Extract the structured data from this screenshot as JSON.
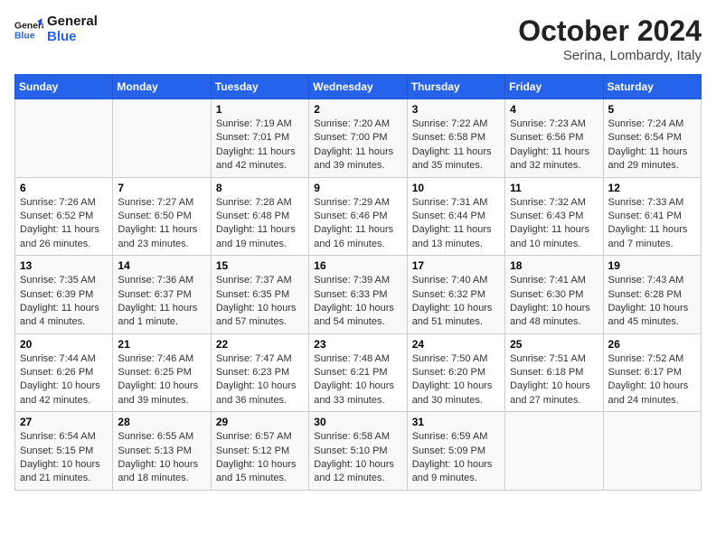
{
  "header": {
    "logo_general": "General",
    "logo_blue": "Blue",
    "month_title": "October 2024",
    "location": "Serina, Lombardy, Italy"
  },
  "days_of_week": [
    "Sunday",
    "Monday",
    "Tuesday",
    "Wednesday",
    "Thursday",
    "Friday",
    "Saturday"
  ],
  "weeks": [
    [
      {
        "day": "",
        "info": ""
      },
      {
        "day": "",
        "info": ""
      },
      {
        "day": "1",
        "info": "Sunrise: 7:19 AM\nSunset: 7:01 PM\nDaylight: 11 hours and 42 minutes."
      },
      {
        "day": "2",
        "info": "Sunrise: 7:20 AM\nSunset: 7:00 PM\nDaylight: 11 hours and 39 minutes."
      },
      {
        "day": "3",
        "info": "Sunrise: 7:22 AM\nSunset: 6:58 PM\nDaylight: 11 hours and 35 minutes."
      },
      {
        "day": "4",
        "info": "Sunrise: 7:23 AM\nSunset: 6:56 PM\nDaylight: 11 hours and 32 minutes."
      },
      {
        "day": "5",
        "info": "Sunrise: 7:24 AM\nSunset: 6:54 PM\nDaylight: 11 hours and 29 minutes."
      }
    ],
    [
      {
        "day": "6",
        "info": "Sunrise: 7:26 AM\nSunset: 6:52 PM\nDaylight: 11 hours and 26 minutes."
      },
      {
        "day": "7",
        "info": "Sunrise: 7:27 AM\nSunset: 6:50 PM\nDaylight: 11 hours and 23 minutes."
      },
      {
        "day": "8",
        "info": "Sunrise: 7:28 AM\nSunset: 6:48 PM\nDaylight: 11 hours and 19 minutes."
      },
      {
        "day": "9",
        "info": "Sunrise: 7:29 AM\nSunset: 6:46 PM\nDaylight: 11 hours and 16 minutes."
      },
      {
        "day": "10",
        "info": "Sunrise: 7:31 AM\nSunset: 6:44 PM\nDaylight: 11 hours and 13 minutes."
      },
      {
        "day": "11",
        "info": "Sunrise: 7:32 AM\nSunset: 6:43 PM\nDaylight: 11 hours and 10 minutes."
      },
      {
        "day": "12",
        "info": "Sunrise: 7:33 AM\nSunset: 6:41 PM\nDaylight: 11 hours and 7 minutes."
      }
    ],
    [
      {
        "day": "13",
        "info": "Sunrise: 7:35 AM\nSunset: 6:39 PM\nDaylight: 11 hours and 4 minutes."
      },
      {
        "day": "14",
        "info": "Sunrise: 7:36 AM\nSunset: 6:37 PM\nDaylight: 11 hours and 1 minute."
      },
      {
        "day": "15",
        "info": "Sunrise: 7:37 AM\nSunset: 6:35 PM\nDaylight: 10 hours and 57 minutes."
      },
      {
        "day": "16",
        "info": "Sunrise: 7:39 AM\nSunset: 6:33 PM\nDaylight: 10 hours and 54 minutes."
      },
      {
        "day": "17",
        "info": "Sunrise: 7:40 AM\nSunset: 6:32 PM\nDaylight: 10 hours and 51 minutes."
      },
      {
        "day": "18",
        "info": "Sunrise: 7:41 AM\nSunset: 6:30 PM\nDaylight: 10 hours and 48 minutes."
      },
      {
        "day": "19",
        "info": "Sunrise: 7:43 AM\nSunset: 6:28 PM\nDaylight: 10 hours and 45 minutes."
      }
    ],
    [
      {
        "day": "20",
        "info": "Sunrise: 7:44 AM\nSunset: 6:26 PM\nDaylight: 10 hours and 42 minutes."
      },
      {
        "day": "21",
        "info": "Sunrise: 7:46 AM\nSunset: 6:25 PM\nDaylight: 10 hours and 39 minutes."
      },
      {
        "day": "22",
        "info": "Sunrise: 7:47 AM\nSunset: 6:23 PM\nDaylight: 10 hours and 36 minutes."
      },
      {
        "day": "23",
        "info": "Sunrise: 7:48 AM\nSunset: 6:21 PM\nDaylight: 10 hours and 33 minutes."
      },
      {
        "day": "24",
        "info": "Sunrise: 7:50 AM\nSunset: 6:20 PM\nDaylight: 10 hours and 30 minutes."
      },
      {
        "day": "25",
        "info": "Sunrise: 7:51 AM\nSunset: 6:18 PM\nDaylight: 10 hours and 27 minutes."
      },
      {
        "day": "26",
        "info": "Sunrise: 7:52 AM\nSunset: 6:17 PM\nDaylight: 10 hours and 24 minutes."
      }
    ],
    [
      {
        "day": "27",
        "info": "Sunrise: 6:54 AM\nSunset: 5:15 PM\nDaylight: 10 hours and 21 minutes."
      },
      {
        "day": "28",
        "info": "Sunrise: 6:55 AM\nSunset: 5:13 PM\nDaylight: 10 hours and 18 minutes."
      },
      {
        "day": "29",
        "info": "Sunrise: 6:57 AM\nSunset: 5:12 PM\nDaylight: 10 hours and 15 minutes."
      },
      {
        "day": "30",
        "info": "Sunrise: 6:58 AM\nSunset: 5:10 PM\nDaylight: 10 hours and 12 minutes."
      },
      {
        "day": "31",
        "info": "Sunrise: 6:59 AM\nSunset: 5:09 PM\nDaylight: 10 hours and 9 minutes."
      },
      {
        "day": "",
        "info": ""
      },
      {
        "day": "",
        "info": ""
      }
    ]
  ]
}
